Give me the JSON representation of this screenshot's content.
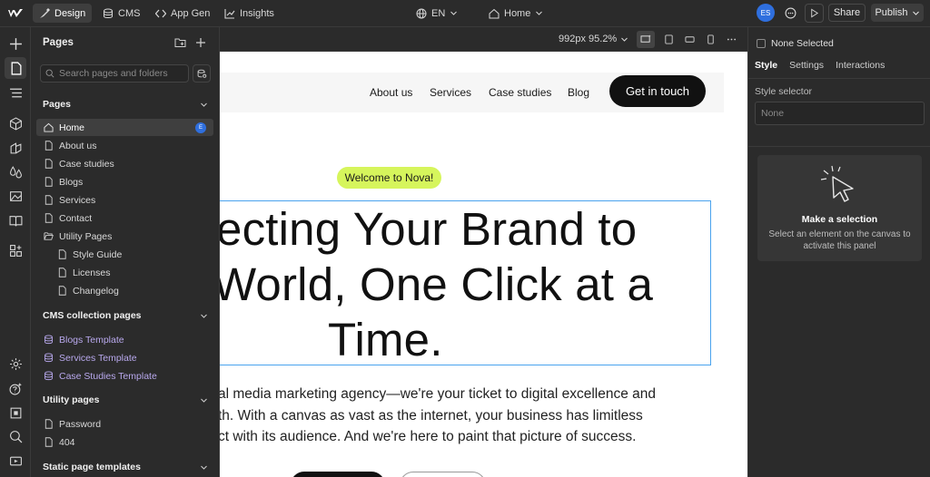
{
  "topbar": {
    "tabs": [
      {
        "label": "Design",
        "icon": "design-icon",
        "active": true
      },
      {
        "label": "CMS",
        "icon": "database-icon"
      },
      {
        "label": "App Gen",
        "icon": "code-icon"
      },
      {
        "label": "Insights",
        "icon": "chart-icon"
      }
    ],
    "language": "EN",
    "current_page": "Home",
    "avatar_initials": "ES",
    "share_label": "Share",
    "publish_label": "Publish"
  },
  "pages_panel": {
    "title": "Pages",
    "search_placeholder": "Search pages and folders",
    "sections": {
      "pages": "Pages",
      "cms": "CMS collection pages",
      "utility": "Utility pages",
      "static": "Static page templates"
    },
    "pages": [
      {
        "label": "Home",
        "selected": true,
        "badge": "E"
      },
      {
        "label": "About us"
      },
      {
        "label": "Case studies"
      },
      {
        "label": "Blogs"
      },
      {
        "label": "Services"
      },
      {
        "label": "Contact"
      },
      {
        "label": "Utility Pages",
        "folder": true
      },
      {
        "label": "Style Guide"
      },
      {
        "label": "Licenses"
      },
      {
        "label": "Changelog"
      }
    ],
    "cms_pages": [
      "Blogs Template",
      "Services Template",
      "Case Studies Template"
    ],
    "utility_pages": [
      "Password",
      "404"
    ]
  },
  "canvas": {
    "breakpoint": "992px 95.2%",
    "nav": [
      "About us",
      "Services",
      "Case studies",
      "Blog"
    ],
    "cta": "Get in touch",
    "welcome": "Welcome to Nova!",
    "hero": [
      "ecting Your Brand to",
      "World, One Click at a",
      "Time."
    ],
    "body": [
      "al media marketing agency—we're your ticket to digital excellence and",
      "th. With a canvas as vast as the internet, your business has limitless",
      "ct with its audience. And we're here to paint that picture of success."
    ]
  },
  "right_panel": {
    "none_selected": "None Selected",
    "tabs": [
      "Style",
      "Settings",
      "Interactions"
    ],
    "style_selector_label": "Style selector",
    "style_selector_value": "None",
    "empty_title": "Make a selection",
    "empty_sub": "Select an element on the canvas to activate this panel"
  },
  "colors": {
    "accent": "#2f6fde",
    "cms": "#b9a9ee",
    "welcome": "#d6f55c",
    "selection": "#4aa3ee"
  }
}
